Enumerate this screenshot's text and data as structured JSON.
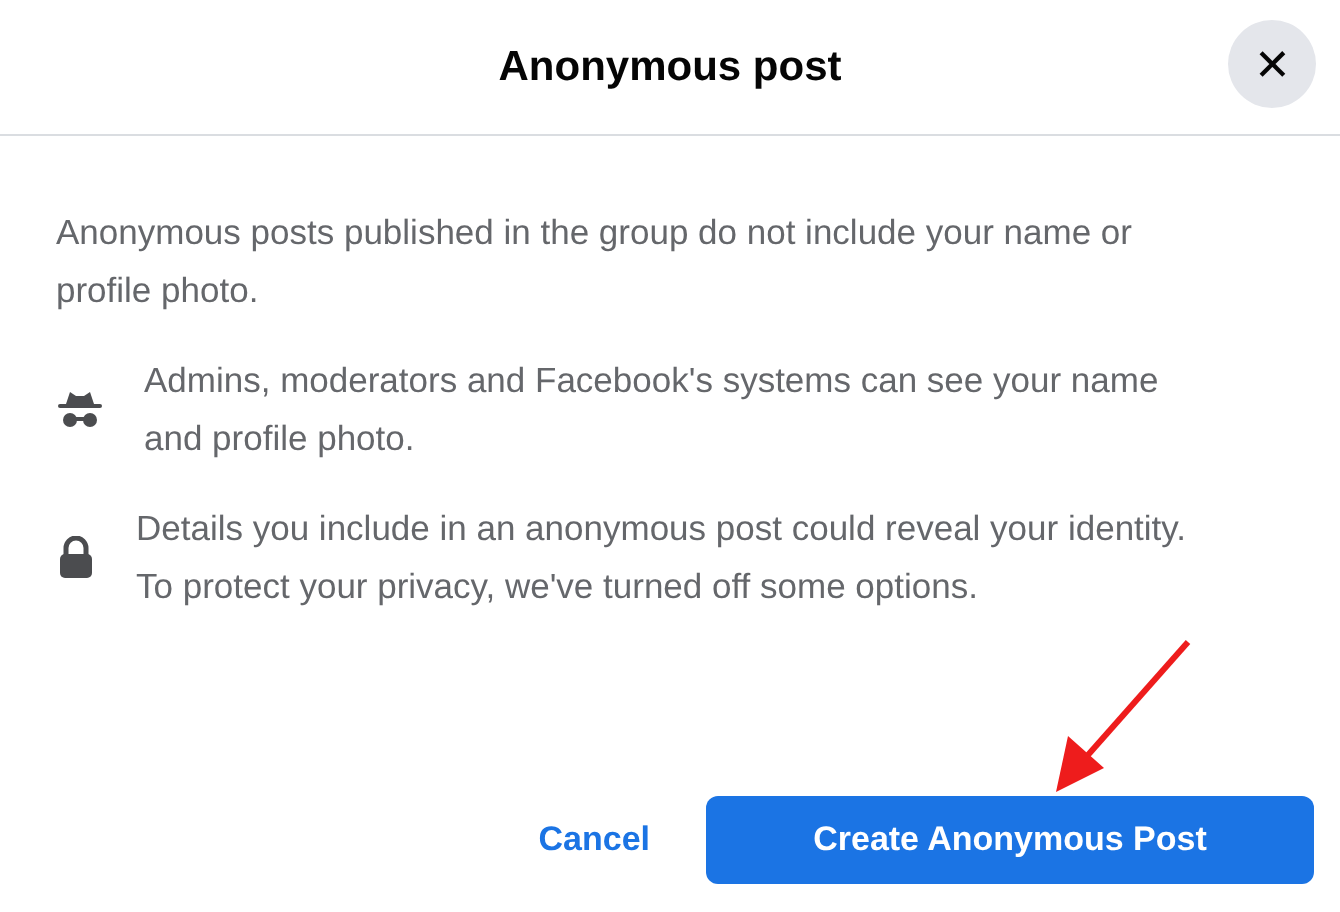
{
  "dialog": {
    "title": "Anonymous post",
    "close_label": "✕",
    "intro": "Anonymous posts published in the group do not include your name or profile photo.",
    "notes": [
      {
        "kind": "incognito",
        "text": "Admins, moderators and Facebook's systems can see your name and profile photo."
      },
      {
        "kind": "lock",
        "text": "Details you include in an anonymous post could reveal your identity. To protect your privacy, we've turned off some options."
      }
    ],
    "buttons": [
      {
        "label": "Cancel",
        "kind": "link"
      },
      {
        "label": "Create Anonymous Post",
        "kind": "primary"
      }
    ]
  }
}
